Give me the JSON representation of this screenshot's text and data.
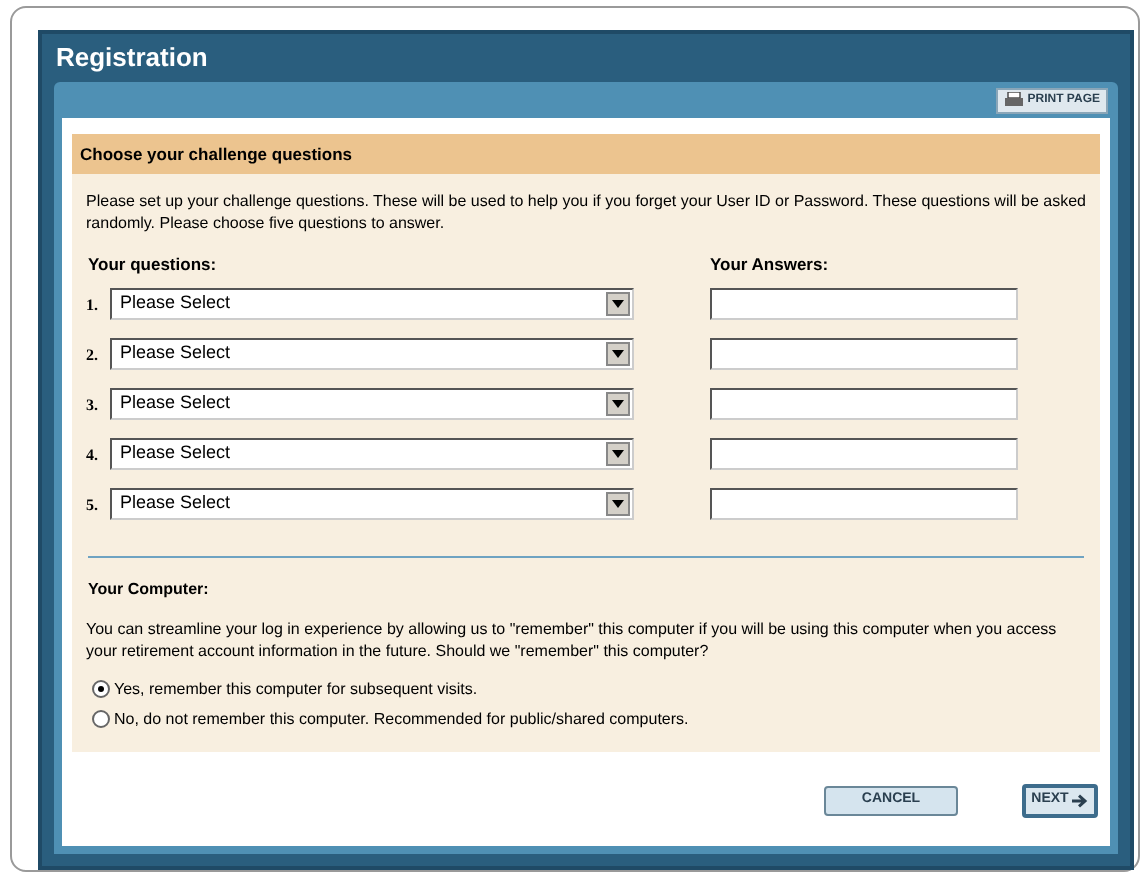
{
  "window": {
    "title": "Registration"
  },
  "print_button": {
    "label": "PRINT PAGE"
  },
  "section": {
    "title": "Choose your challenge questions",
    "intro": "Please set up your challenge questions. These will be used to help you if you forget your User ID or Password. These questions will be asked randomly. Please choose five questions to answer.",
    "questions_heading": "Your questions:",
    "answers_heading": "Your Answers:",
    "questions": [
      {
        "number": "1.",
        "select": "Please Select"
      },
      {
        "number": "2.",
        "select": "Please Select"
      },
      {
        "number": "3.",
        "select": "Please Select"
      },
      {
        "number": "4.",
        "select": "Please Select"
      },
      {
        "number": "5.",
        "select": "Please Select"
      }
    ]
  },
  "computer": {
    "heading": "Your Computer:",
    "text": "You can streamline your log in experience by allowing us to \"remember\" this computer if you will be using this computer when you access your retirement account information in the future. Should we \"remember\" this computer?",
    "options": [
      {
        "label": "Yes, remember this computer for subsequent visits.",
        "selected": true
      },
      {
        "label": "No, do not remember this computer. Recommended for public/shared computers.",
        "selected": false
      }
    ]
  },
  "buttons": {
    "cancel": "CANCEL",
    "next": "NEXT"
  }
}
